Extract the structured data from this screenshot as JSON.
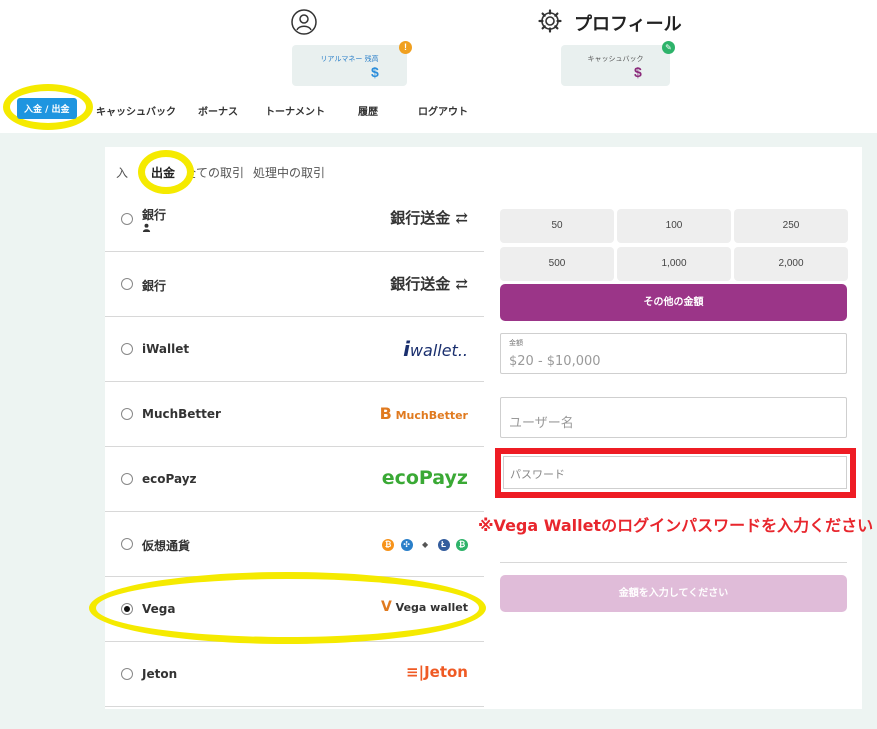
{
  "header": {
    "profile_title": "プロフィール",
    "icons": {
      "user": "user-icon",
      "settings": "gear-icon"
    }
  },
  "balances": {
    "real": {
      "label": "リアルマネー 残高",
      "value": "$",
      "badge": "!"
    },
    "cashback": {
      "label": "キャッシュバック",
      "value": "$",
      "badge": "✎"
    }
  },
  "nav": {
    "items": [
      {
        "label": "入金 / 出金",
        "active": true
      },
      {
        "label": "キャッシュバック"
      },
      {
        "label": "ボーナス"
      },
      {
        "label": "トーナメント"
      },
      {
        "label": "履歴"
      },
      {
        "label": "ログアウト"
      }
    ]
  },
  "subtabs": [
    "入",
    "出金",
    "全ての取引",
    "処理中の取引"
  ],
  "methods": [
    {
      "name": "銀行",
      "logo": "銀行送金",
      "checked": false
    },
    {
      "name": "銀行",
      "logo": "銀行送金",
      "checked": false
    },
    {
      "name": "iWallet",
      "logo": "wallet..",
      "checked": false
    },
    {
      "name": "MuchBetter",
      "logo": "MuchBetter",
      "checked": false
    },
    {
      "name": "ecoPayz",
      "logo": "ecoPayz",
      "checked": false
    },
    {
      "name": "仮想通貨",
      "logo": "crypto",
      "checked": false
    },
    {
      "name": "Vega",
      "logo": "Vega wallet",
      "checked": true
    },
    {
      "name": "Jeton",
      "logo": "Jeton",
      "checked": false
    }
  ],
  "amounts": [
    "50",
    "100",
    "250",
    "500",
    "1,000",
    "2,000"
  ],
  "other_amount": "その他の金額",
  "amount_field": {
    "label": "金額",
    "placeholder": "$20 - $10,000"
  },
  "username_field": {
    "placeholder": "ユーザー名"
  },
  "password_field": {
    "placeholder": "パスワード"
  },
  "warning": "※Vega Walletのログインパスワードを入力ください",
  "submit_label": "金額を入力してください",
  "colors": {
    "accent_blue": "#1e95e0",
    "primary_purple": "#9b3588",
    "disabled_purple": "#e0bcd9",
    "highlight_yellow": "#f5ea00",
    "alert_red": "#ee1c24"
  }
}
